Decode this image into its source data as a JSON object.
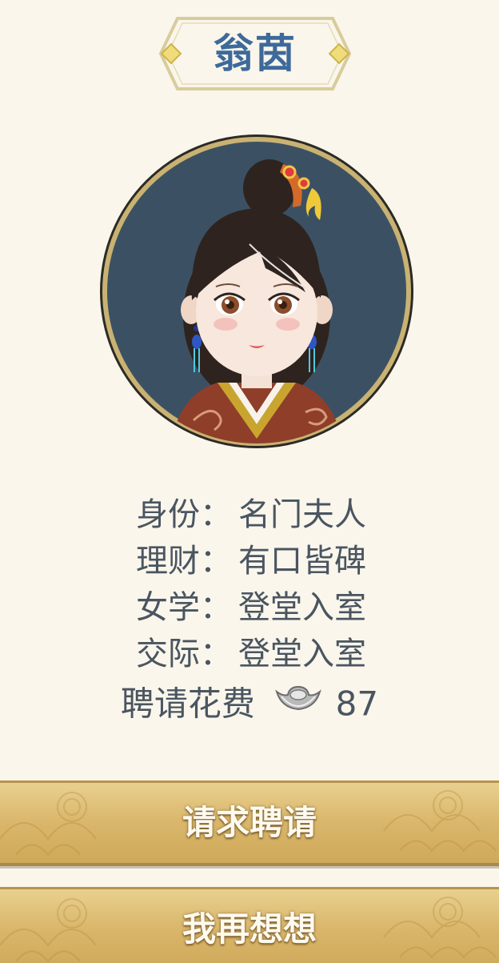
{
  "title": "翁茵",
  "portrait": {
    "icon": "lady-portrait",
    "colors": {
      "background": "#3b5163",
      "frame": "#c9b272",
      "hair": "#2e231e",
      "robe": "#8f3e2a",
      "collar": "#c9a52f"
    }
  },
  "attributes": [
    {
      "label": "身份：",
      "value": "名门夫人"
    },
    {
      "label": "理财：",
      "value": "有口皆碑"
    },
    {
      "label": "女学：",
      "value": "登堂入室"
    },
    {
      "label": "交际：",
      "value": "登堂入室"
    }
  ],
  "cost": {
    "label": "聘请花费",
    "icon": "silver-ingot-icon",
    "amount": "87"
  },
  "buttons": {
    "request": "请求聘请",
    "think": "我再想想"
  },
  "colors": {
    "title_text": "#3d6a9a",
    "text": "#4a5560",
    "button_gold": "#d9b66a",
    "page_background": "#faf6ec"
  }
}
